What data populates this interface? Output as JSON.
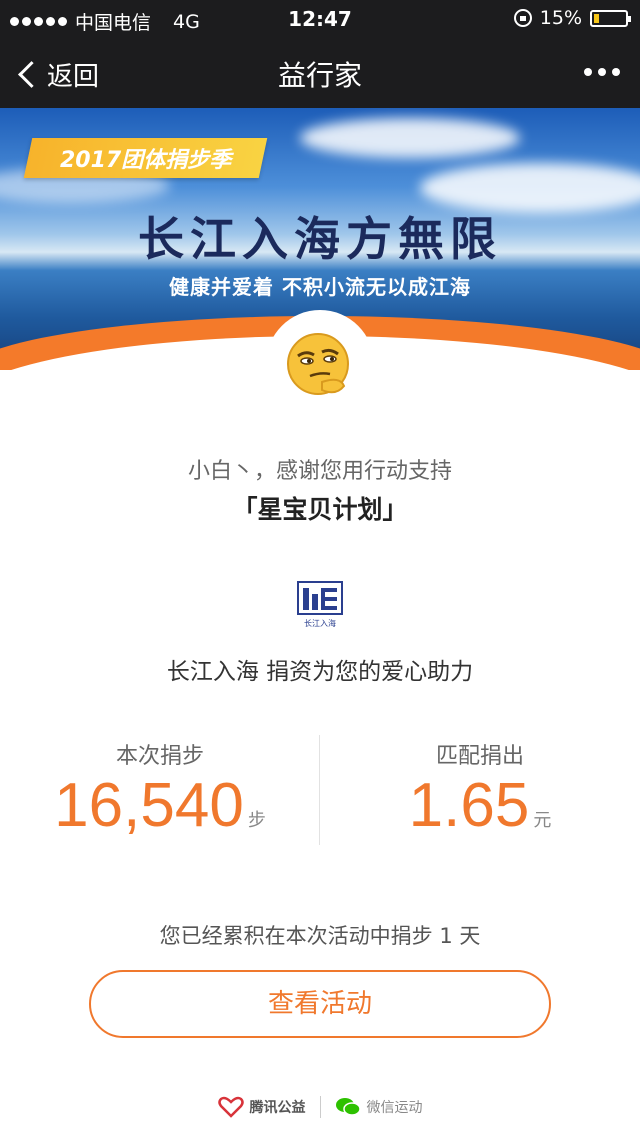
{
  "status_bar": {
    "carrier": "中国电信",
    "network": "4G",
    "time": "12:47",
    "battery": "15%",
    "battery_level": 0.15
  },
  "nav": {
    "back_label": "返回",
    "title": "益行家"
  },
  "banner": {
    "ribbon": "2017团体捐步季",
    "title": "长江入海方無限",
    "subtitle": "健康并爱着 不积小流无以成江海"
  },
  "content": {
    "thanks": "小白丶，感谢您用行动支持",
    "plan": "「星宝贝计划」",
    "donor_logo_text": "长江入海",
    "donor_line": "长江入海 捐资为您的爱心助力"
  },
  "stats": {
    "steps_label": "本次捐步",
    "steps_value": "16,540",
    "steps_unit": "步",
    "match_label": "匹配捐出",
    "match_value": "1.65",
    "match_unit": "元"
  },
  "cumulative": "您已经累积在本次活动中捐步 1 天",
  "button": {
    "label": "查看活动"
  },
  "footer": {
    "left": "腾讯公益",
    "right": "微信运动"
  },
  "colors": {
    "accent": "#f0782d",
    "nav_bg": "#1c1c1e"
  }
}
